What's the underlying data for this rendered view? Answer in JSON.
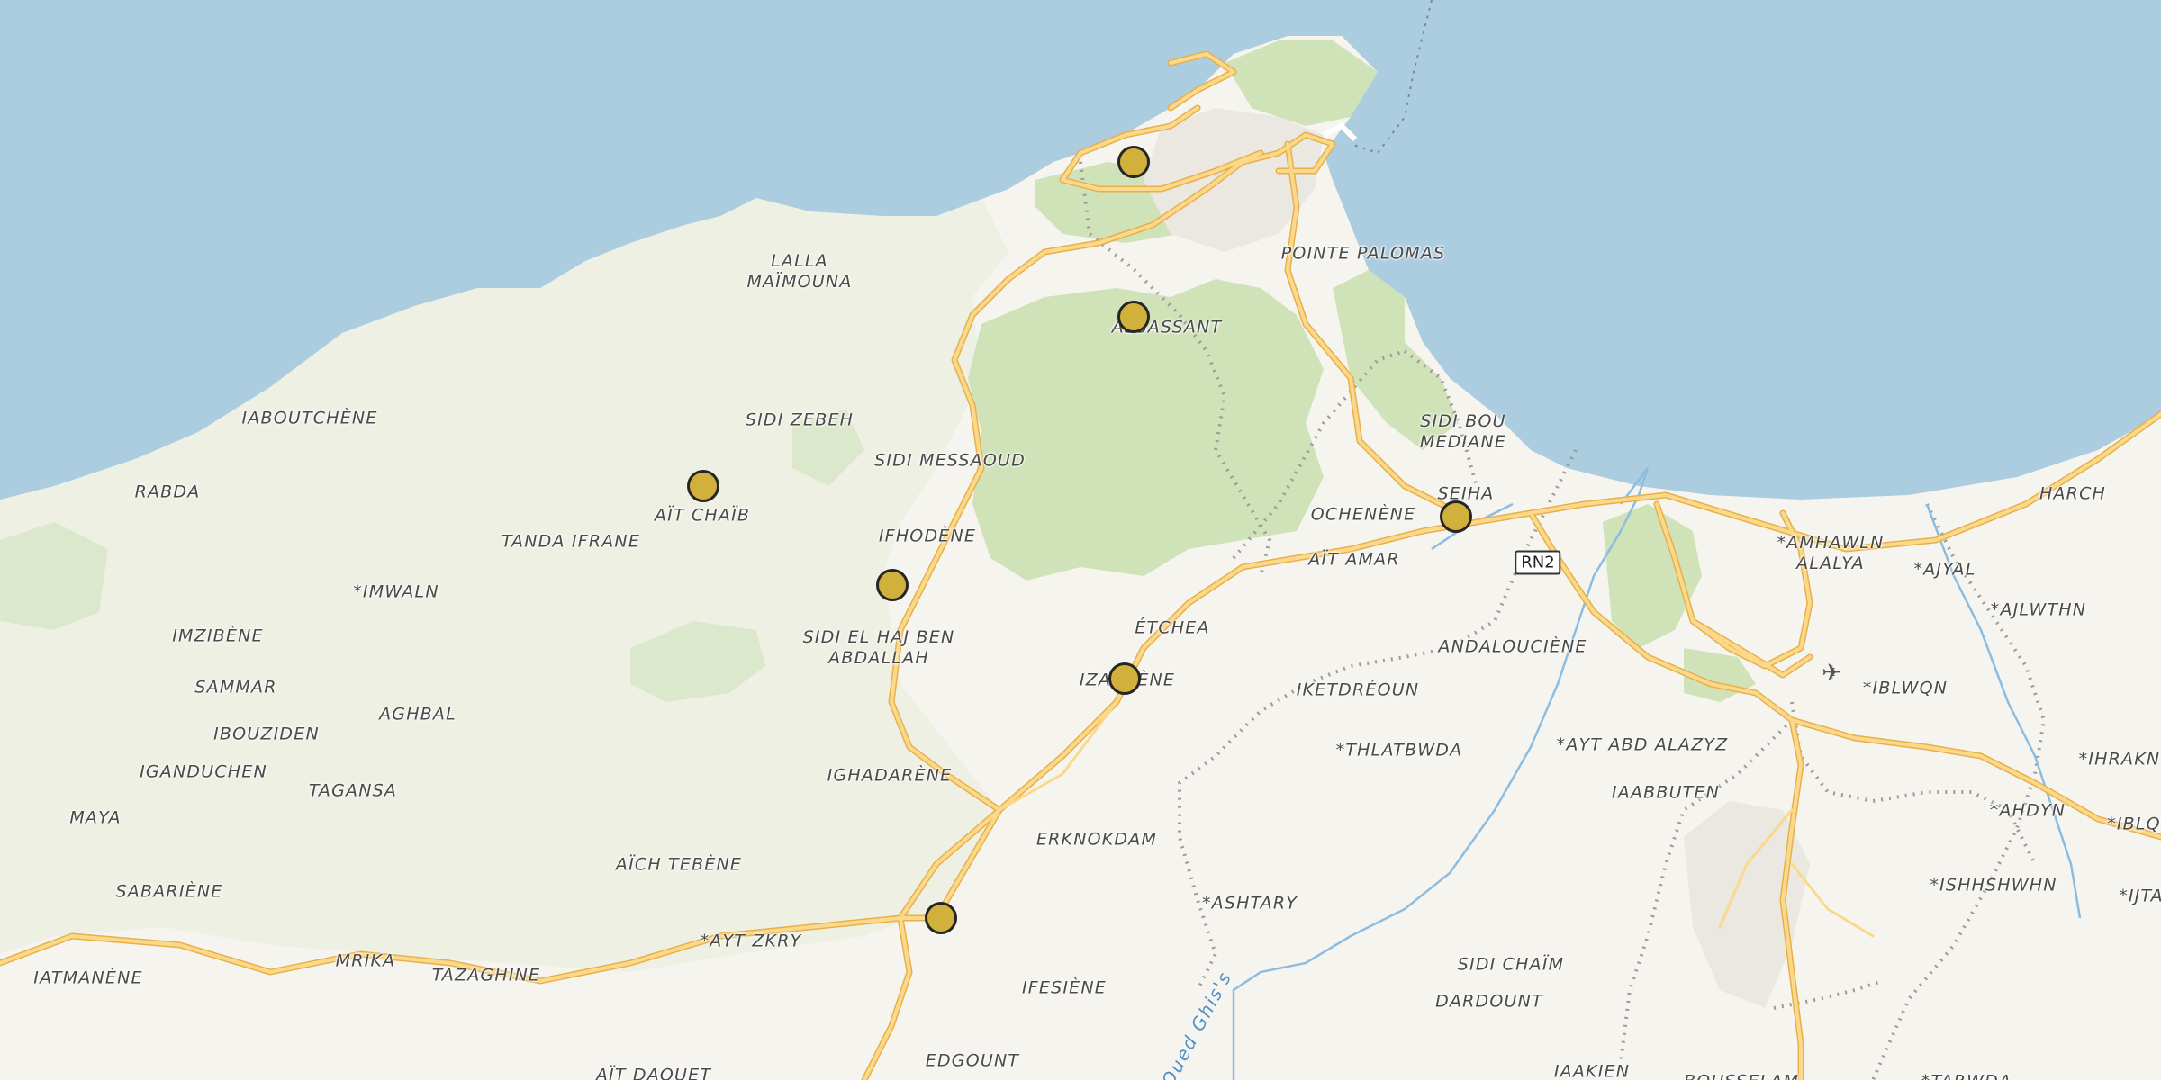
{
  "map": {
    "colors": {
      "sea": "#acccdf",
      "land": "#f6f4ef",
      "park": "#eef0e4",
      "forest": "#cfe2b8",
      "urban": "#ebe8e2",
      "road": "#f5c86a",
      "river": "#8cbde0",
      "boundary": "#9b9b9b",
      "marker": "#d2b03c"
    },
    "labels": [
      {
        "text": "LALLA\nMAÏMOUNA"
      },
      {
        "text": "POINTE PALOMAS"
      },
      {
        "text": "ASSASSANT"
      },
      {
        "text": "IABOUTCHÈNE"
      },
      {
        "text": "SIDI ZEBEH"
      },
      {
        "text": "SIDI BOU\nMEDIANE"
      },
      {
        "text": "RABDA"
      },
      {
        "text": "SIDI MESSAOUD"
      },
      {
        "text": "SEIHA"
      },
      {
        "text": "HARCH"
      },
      {
        "text": "OCHENÈNE"
      },
      {
        "text": "AÏT CHAÏB"
      },
      {
        "text": "TANDA IFRANE"
      },
      {
        "text": "IFHODÈNE"
      },
      {
        "text": "*AMHAWLN\nALALYA"
      },
      {
        "text": "AÏT AMAR"
      },
      {
        "text": "*AJYAL"
      },
      {
        "text": "*AJLWTHN"
      },
      {
        "text": "*IMWALN"
      },
      {
        "text": "ÉTCHEA"
      },
      {
        "text": "IMZIBÈNE"
      },
      {
        "text": "SIDI EL HAJ BEN\nABDALLAH"
      },
      {
        "text": "ANDALOUCIÈNE"
      },
      {
        "text": "IZAKHÈNE"
      },
      {
        "text": "SAMMAR"
      },
      {
        "text": "IKETDRÉOUN"
      },
      {
        "text": "*IBLWQN"
      },
      {
        "text": "AGHBAL"
      },
      {
        "text": "IBOUZIDEN"
      },
      {
        "text": "*AYT ABD ALAZYZ"
      },
      {
        "text": "*THLATBWDA"
      },
      {
        "text": "*IHRAKN"
      },
      {
        "text": "IGANDUCHEN"
      },
      {
        "text": "IGHADARÈNE"
      },
      {
        "text": "TAGANSA"
      },
      {
        "text": "IAABBUTEN"
      },
      {
        "text": "*AHDYN"
      },
      {
        "text": "MAYA"
      },
      {
        "text": "*IBLQ"
      },
      {
        "text": "ERKNOKDAM"
      },
      {
        "text": "AÏCH TEBÈNE"
      },
      {
        "text": "*ISHHSHWHN"
      },
      {
        "text": "SABARIÈNE"
      },
      {
        "text": "*IJTA"
      },
      {
        "text": "*ASHTARY"
      },
      {
        "text": "*AYT ZKRY"
      },
      {
        "text": "MRIKA"
      },
      {
        "text": "TAZAGHINE"
      },
      {
        "text": "SIDI CHAÏM"
      },
      {
        "text": "IATMANÈNE"
      },
      {
        "text": "IFESIÈNE"
      },
      {
        "text": "DARDOUNT"
      },
      {
        "text": "AÏT DAOUET"
      },
      {
        "text": "EDGOUNT"
      },
      {
        "text": "IAAKIEN"
      },
      {
        "text": "BOUSSELAM"
      },
      {
        "text": "*TARWDA"
      }
    ],
    "road_shield": "RN2",
    "river_name": "Oued Ghis's",
    "airport_icon": "airplane-icon",
    "markers": 7
  }
}
